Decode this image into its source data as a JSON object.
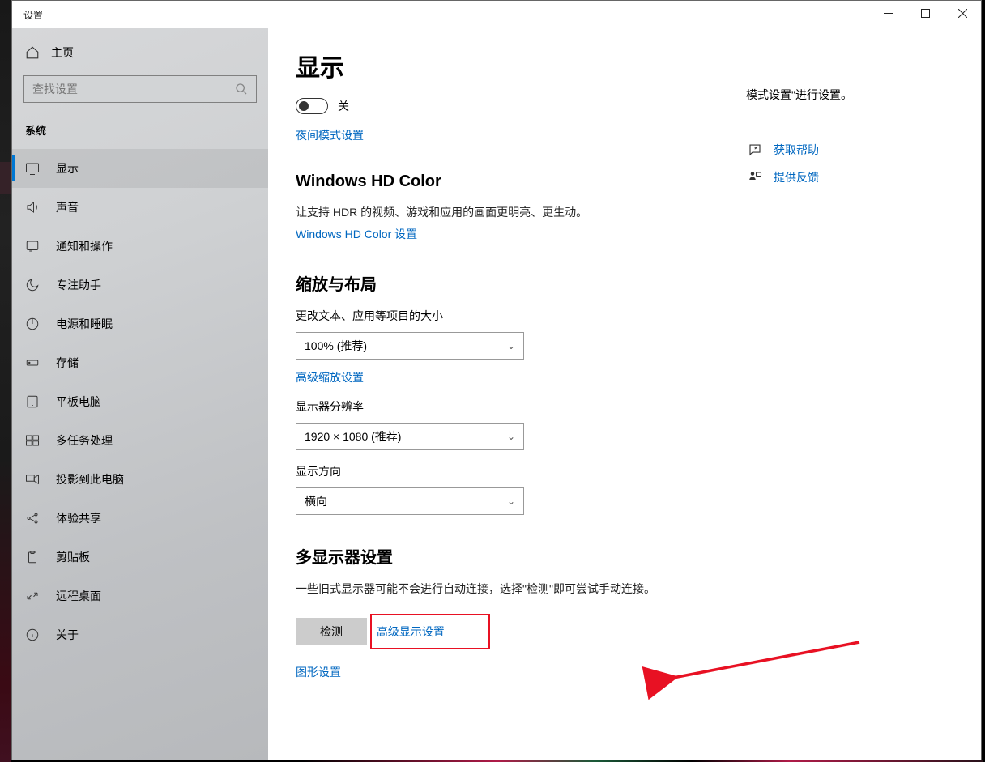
{
  "window": {
    "title": "设置"
  },
  "sidebar": {
    "home": "主页",
    "search_placeholder": "查找设置",
    "category": "系统",
    "items": [
      {
        "label": "显示"
      },
      {
        "label": "声音"
      },
      {
        "label": "通知和操作"
      },
      {
        "label": "专注助手"
      },
      {
        "label": "电源和睡眠"
      },
      {
        "label": "存储"
      },
      {
        "label": "平板电脑"
      },
      {
        "label": "多任务处理"
      },
      {
        "label": "投影到此电脑"
      },
      {
        "label": "体验共享"
      },
      {
        "label": "剪贴板"
      },
      {
        "label": "远程桌面"
      },
      {
        "label": "关于"
      }
    ]
  },
  "main": {
    "title": "显示",
    "night_light": {
      "toggle_state": "关",
      "settings_link": "夜间模式设置"
    },
    "hd_color": {
      "heading": "Windows HD Color",
      "desc": "让支持 HDR 的视频、游戏和应用的画面更明亮、更生动。",
      "settings_link": "Windows HD Color 设置"
    },
    "scale": {
      "heading": "缩放与布局",
      "label_scale": "更改文本、应用等项目的大小",
      "value_scale": "100% (推荐)",
      "adv_scale_link": "高级缩放设置",
      "label_res": "显示器分辨率",
      "value_res": "1920 × 1080 (推荐)",
      "label_orient": "显示方向",
      "value_orient": "横向"
    },
    "multi": {
      "heading": "多显示器设置",
      "desc": "一些旧式显示器可能不会进行自动连接，选择\"检测\"即可尝试手动连接。",
      "detect_btn": "检测",
      "adv_display_link": "高级显示设置",
      "graphics_link": "图形设置"
    }
  },
  "aside": {
    "note": "模式设置\"进行设置。",
    "help_link": "获取帮助",
    "feedback_link": "提供反馈"
  }
}
